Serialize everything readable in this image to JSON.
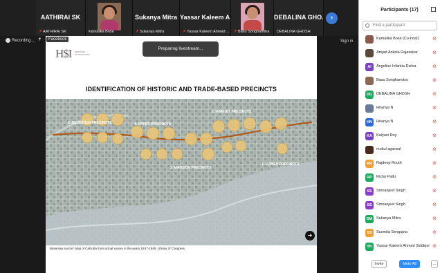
{
  "video_strip": {
    "tiles": [
      {
        "name": "AATHIRAI SK",
        "label": "AATHIRAI SK"
      },
      {
        "name": "",
        "label": "Kamalika Bose"
      },
      {
        "name": "Sukanya Mitra",
        "label": "Sukanya Mitra"
      },
      {
        "name": "Yassar Kaleem A...",
        "label": "Yassar Kaleem Ahmad ..."
      },
      {
        "name": "",
        "label": "Basu Songhamitra"
      },
      {
        "name": "DEBALINA GHO...",
        "label": "DEBALINA GHOSH"
      }
    ],
    "next_icon": "chevron-right-icon"
  },
  "toolbar": {
    "recording_label": "Recording...",
    "facebook_label": "Facebook",
    "signin_label": "Sign in"
  },
  "slide": {
    "logo_mark": "H$I",
    "logo_sub": "HERITAGE STUDIES INDIA",
    "preparing_text": "Preparing livestream...",
    "title": "IDENTIFICATION OF HISTORIC AND TRADE-BASED PRECINCTS",
    "map_labels": {
      "religious": "5. RELIGIOUS PRECINCTS",
      "upper": "4. UPPER PRECINCTS",
      "market": "2. MARKET PRECINCTS",
      "mansion": "3. MANSION PRECINCTS",
      "lower": "1. LOWER PRECINCTS"
    },
    "caption": "Basemap source: Map of Calcutta from actual survey in the years 1847-1849, Library of Congress"
  },
  "panel": {
    "title": "Participants (17)",
    "search_placeholder": "Find a participant",
    "participants": [
      {
        "name": "Kamalika Bose (Co-host)",
        "initials": "",
        "color": "#8b5a4a"
      },
      {
        "name": "Amjad Ankala Rajasekar",
        "initials": "",
        "color": "#5a4a3a"
      },
      {
        "name": "Angeline Infantia Dsilva",
        "initials": "AI",
        "color": "#7b3fc4"
      },
      {
        "name": "Basu Songhamitra",
        "initials": "",
        "color": "#8b6a55"
      },
      {
        "name": "DEBALINA GHOSH",
        "initials": "DG",
        "color": "#1aab5e"
      },
      {
        "name": "Hiranya N",
        "initials": "",
        "color": "#6a7a9a"
      },
      {
        "name": "Hiranya N",
        "initials": "HN",
        "color": "#2d6ad9"
      },
      {
        "name": "Kalyani Roy",
        "initials": "KA",
        "color": "#7b3fc4"
      },
      {
        "name": "mukul agarwal",
        "initials": "",
        "color": "#4a2a1a"
      },
      {
        "name": "Rajdeep Routh",
        "initials": "RR",
        "color": "#f0a030"
      },
      {
        "name": "Richa Patki",
        "initials": "RP",
        "color": "#1aab5e"
      },
      {
        "name": "Simranjeet Singh",
        "initials": "SS",
        "color": "#8a3fc4"
      },
      {
        "name": "Simranjeet Singh",
        "initials": "SS",
        "color": "#8a3fc4"
      },
      {
        "name": "Sukanya Mitra",
        "initials": "SM",
        "color": "#1aab5e"
      },
      {
        "name": "Susmita Sengupta",
        "initials": "SS",
        "color": "#f0a030"
      },
      {
        "name": "Yassar Kaleem Ahmad Siddiqui",
        "initials": "YK",
        "color": "#1aab5e"
      }
    ],
    "invite_label": "Invite",
    "mute_all_label": "Mute All",
    "more_label": "..."
  }
}
